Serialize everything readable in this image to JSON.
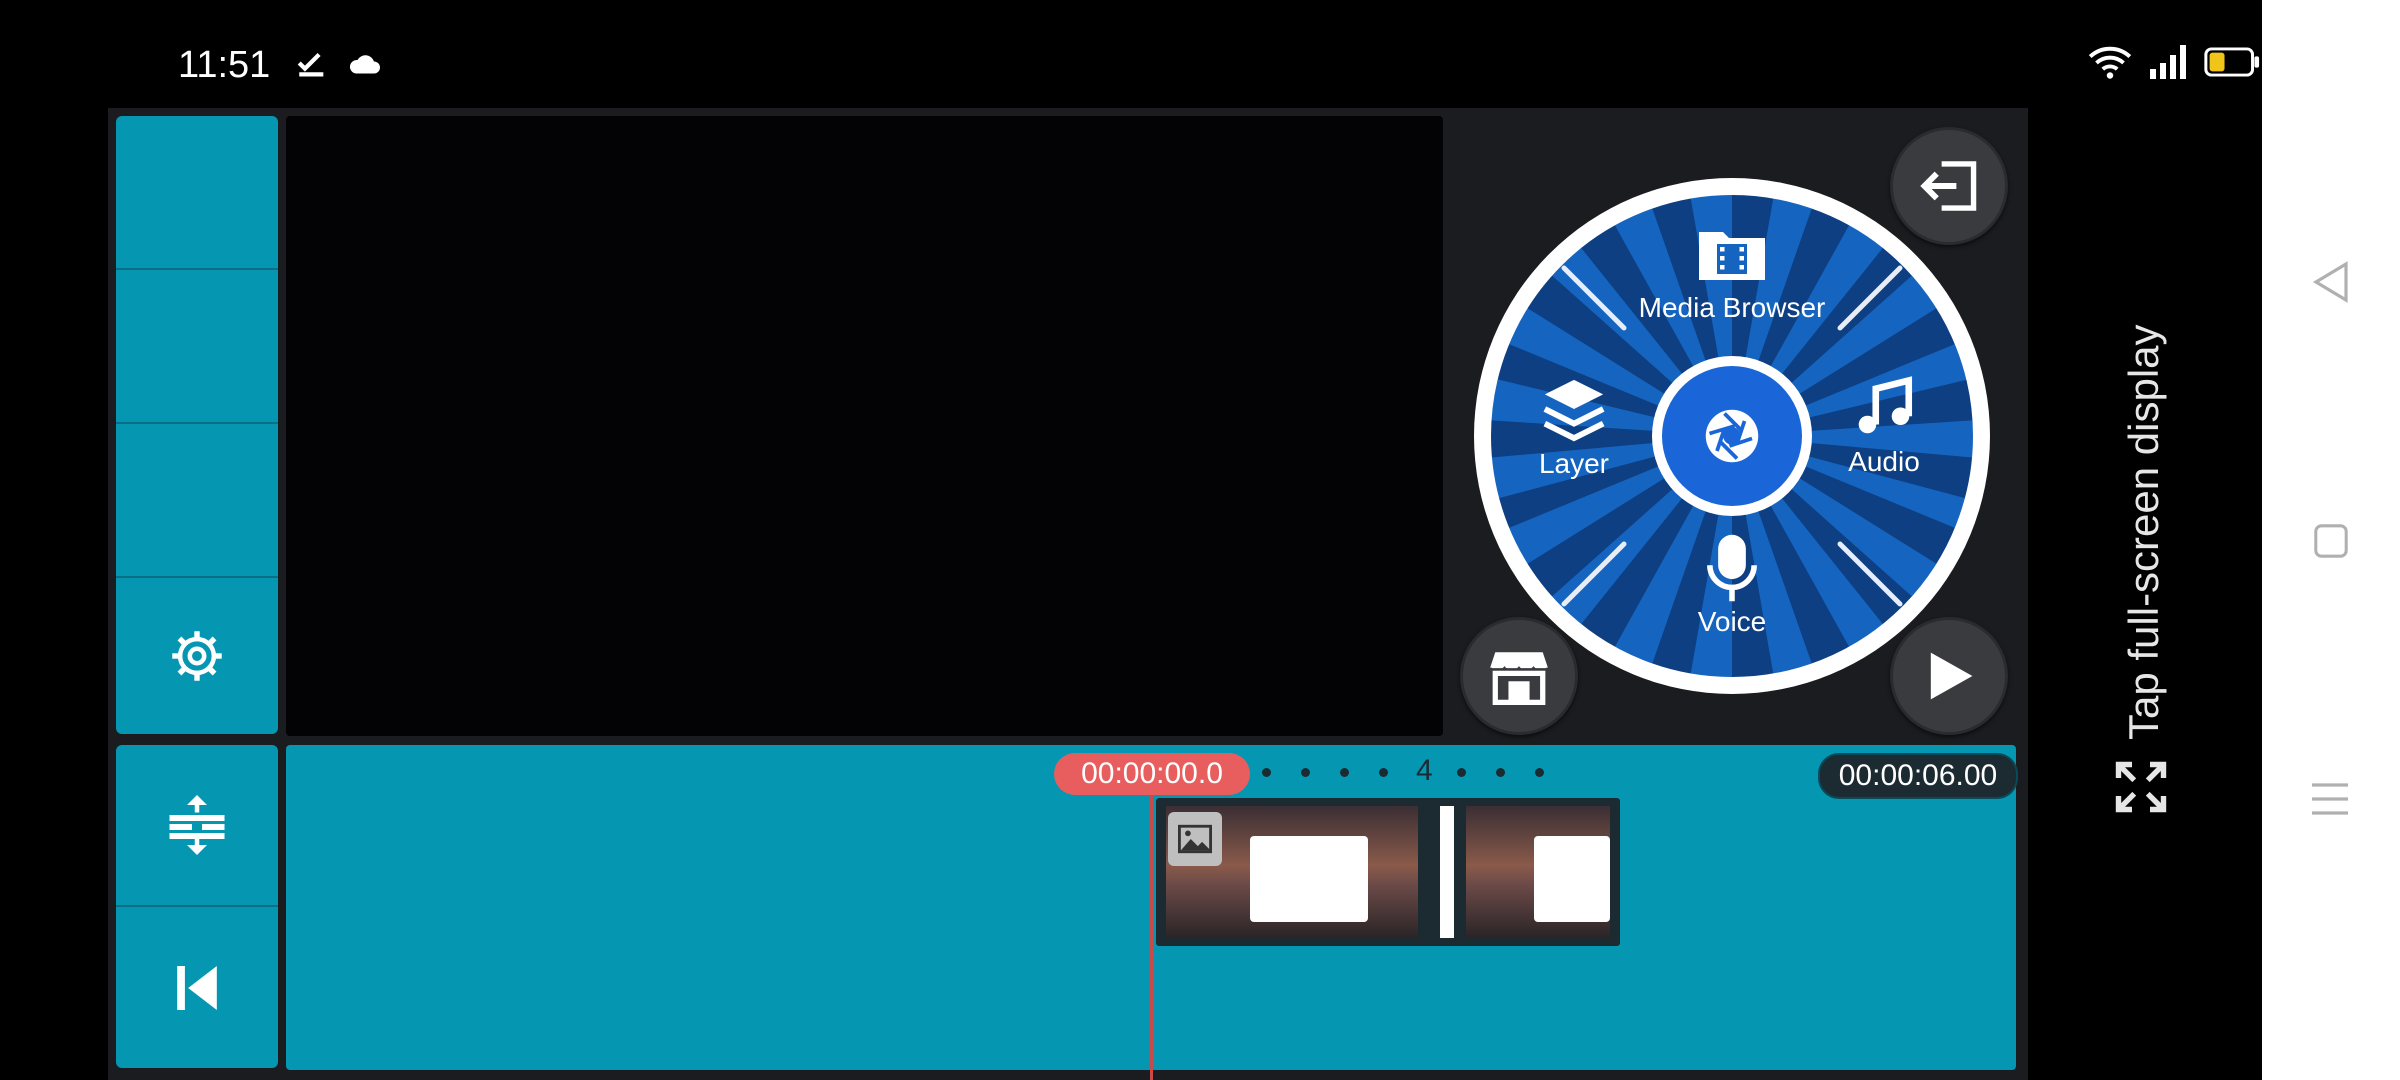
{
  "status_bar": {
    "time": "11:51"
  },
  "timeline": {
    "playhead_time": "00:00:00.0",
    "end_time": "00:00:06.00",
    "beat_number": "4"
  },
  "wheel": {
    "media_browser_label": "Media Browser",
    "layer_label": "Layer",
    "audio_label": "Audio",
    "voice_label": "Voice"
  },
  "fullscreen_hint": "Tap full-screen display",
  "colors": {
    "accent": "#0597b2",
    "playhead": "#e85e5e",
    "wheel_blue": "#1565c0"
  }
}
